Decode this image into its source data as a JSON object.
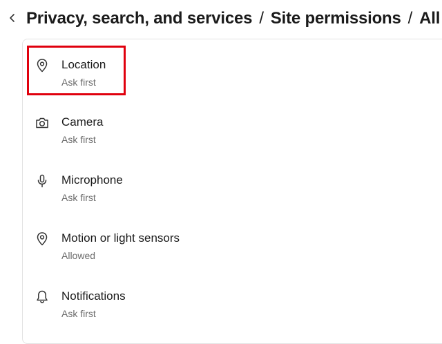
{
  "header": {
    "breadcrumb": [
      "Privacy, search, and services",
      "Site permissions",
      "All"
    ],
    "separator": "/"
  },
  "permissions": [
    {
      "label": "Location",
      "status": "Ask first",
      "icon": "location-pin-icon"
    },
    {
      "label": "Camera",
      "status": "Ask first",
      "icon": "camera-icon"
    },
    {
      "label": "Microphone",
      "status": "Ask first",
      "icon": "microphone-icon"
    },
    {
      "label": "Motion or light sensors",
      "status": "Allowed",
      "icon": "sensor-pin-icon"
    },
    {
      "label": "Notifications",
      "status": "Ask first",
      "icon": "bell-icon"
    }
  ],
  "annotation": {
    "highlight_color": "#e0000d",
    "highlighted_item": "Location"
  }
}
